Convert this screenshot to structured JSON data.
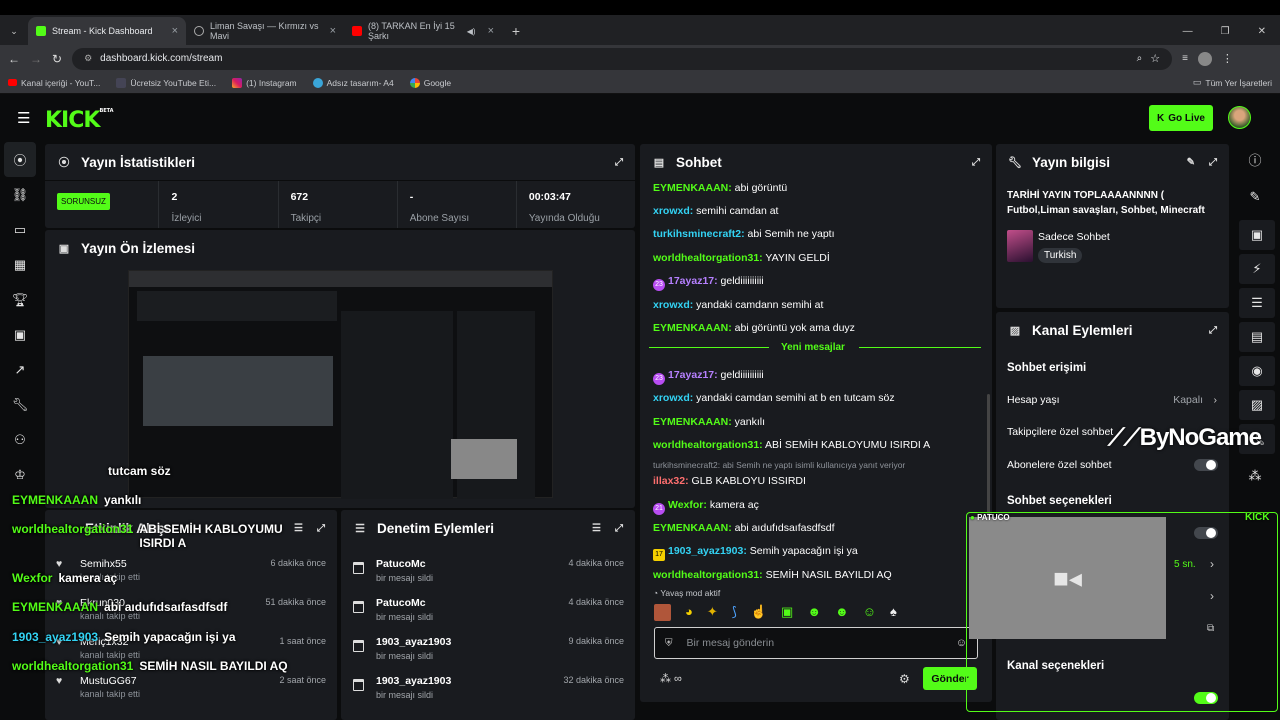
{
  "browser": {
    "tabs": [
      {
        "label": "Stream - Kick Dashboard"
      },
      {
        "label": "Liman Savaşı — Kırmızı vs Mavi"
      },
      {
        "label": "(8) TARKAN En İyi 15 Şarkı"
      }
    ],
    "url": "dashboard.kick.com/stream",
    "bookmarks": [
      "Kanal içeriği - YouT...",
      "Ücretsiz YouTube Eti...",
      "(1) Instagram",
      "Adsız tasarım- A4",
      "Google"
    ],
    "all_bookmarks": "Tüm Yer İşaretleri"
  },
  "nav": {
    "logo": "KICK",
    "logo_beta": "BETA",
    "go_live": "Go Live"
  },
  "stats_panel": {
    "title": "Yayın İstatistikleri",
    "badge": "SORUNSUZ",
    "viewers": "2",
    "viewers_label": "İzleyici",
    "followers": "672",
    "followers_label": "Takipçi",
    "subs": "-",
    "subs_label": "Abone Sayısı",
    "uptime": "00:03:47",
    "uptime_label": "Yayında Olduğu"
  },
  "preview_panel": {
    "title": "Yayın Ön İzlemesi"
  },
  "chat_panel": {
    "title": "Sohbet",
    "new_messages": "Yeni mesajlar",
    "slow_mode": "Yavaş mod aktif",
    "input_placeholder": "Bir mesaj gönderin",
    "send": "Gönder",
    "messages": [
      {
        "user": "EYMENKAAAN:",
        "text": " abi görüntü"
      },
      {
        "user": "xrowxd:",
        "text": " semihi camdan at"
      },
      {
        "user": "turkihsminecraft2:",
        "text": " abi Semih ne yaptı"
      },
      {
        "user": "worldhealtorgation31:",
        "text": " YAYIN GELDİ"
      },
      {
        "user": "17ayaz17:",
        "text": " geldiiiiiiiiii",
        "badge": "23"
      },
      {
        "user": "xrowxd:",
        "text": " yandaki camdann semihi at"
      },
      {
        "user": "EYMENKAAAN:",
        "text": " abi görüntü yok ama duyz"
      },
      {
        "user": "17ayaz17:",
        "text": " geldiiiiiiiiii",
        "badge": "23"
      },
      {
        "user": "xrowxd:",
        "text": " yandaki camdan semihi at b en tutcam söz"
      },
      {
        "user": "EYMENKAAAN:",
        "text": " yankılı"
      },
      {
        "user": "worldhealtorgation31:",
        "text": " ABİ SEMİH KABLOYUMU ISIRDI A"
      },
      {
        "reply": "turkihsminecraft2: abi Semih ne yaptı isimli kullanıcıya yanıt veriyor"
      },
      {
        "user": "illax32:",
        "text": " GLB KABLOYU ISSIRDI"
      },
      {
        "user": "Wexfor:",
        "text": " kamera aç",
        "badge": "21"
      },
      {
        "user": "EYMENKAAAN:",
        "text": " abi aıdufıdsaıfasdfsdf"
      },
      {
        "user": "1903_ayaz1903:",
        "text": " Semih yapacağın işi ya",
        "badge": "17"
      },
      {
        "user": "worldhealtorgation31:",
        "text": " SEMİH NASIL BAYILDI AQ"
      }
    ]
  },
  "info_panel": {
    "title": "Yayın bilgisi",
    "stream_title": "TARİHİ YAYIN TOPLAAAANNNN ( Futbol,Liman savaşları, Sohbet, Minecraft",
    "category": "Sadece Sohbet",
    "language": "Turkish"
  },
  "channel_panel": {
    "title": "Kanal Eylemleri",
    "chat_access": "Sohbet erişimi",
    "account_age": "Hesap yaşı",
    "account_age_value": "Kapalı",
    "followers_only": "Takipçilere özel sohbet",
    "subs_only": "Abonelere özel sohbet",
    "chat_options": "Sohbet seçenekleri",
    "slow_value": "5 sn.",
    "channel_options": "Kanal seçenekleri"
  },
  "activity_panel": {
    "title": "Etkinlik Akışı",
    "items": [
      {
        "name": "Semihx55",
        "desc": "kanalı takip etti",
        "time": "6 dakika önce"
      },
      {
        "name": "Ekrun030",
        "desc": "kanalı takip etti",
        "time": "51 dakika önce"
      },
      {
        "name": "Meriç1x32",
        "desc": "kanalı takip etti",
        "time": "1 saat önce"
      },
      {
        "name": "MustuGG67",
        "desc": "kanalı takip etti",
        "time": "2 saat önce"
      }
    ]
  },
  "mod_panel": {
    "title": "Denetim Eylemleri",
    "items": [
      {
        "name": "PatucoMc",
        "desc": "bir mesajı sildi",
        "time": "4 dakika önce"
      },
      {
        "name": "PatucoMc",
        "desc": "bir mesajı sildi",
        "time": "4 dakika önce"
      },
      {
        "name": "1903_ayaz1903",
        "desc": "bir mesajı sildi",
        "time": "9 dakika önce"
      },
      {
        "name": "1903_ayaz1903",
        "desc": "bir mesajı sildi",
        "time": "32 dakika önce"
      }
    ]
  },
  "overlay": {
    "chat": [
      {
        "user": "",
        "text": "tutcam söz"
      },
      {
        "user": "EYMENKAAAN",
        "text": "yankılı"
      },
      {
        "user": "worldhealtorgation31",
        "text": "ABİ SEMİH KABLOYUMU ISIRDI A"
      },
      {
        "user": "Wexfor",
        "text": "kamera aç"
      },
      {
        "user": "EYMENKAAAN",
        "text": "abi aıdufıdsaıfasdfsdf"
      },
      {
        "user": "1903_ayaz1903",
        "text": "Semih yapacağın işi ya"
      },
      {
        "user": "worldhealtorgation31",
        "text": "SEMİH NASIL BAYILDI AQ"
      }
    ],
    "watermark": "ByNoGame",
    "cam_user": "PATUCO",
    "cam_brand": "KICK"
  }
}
